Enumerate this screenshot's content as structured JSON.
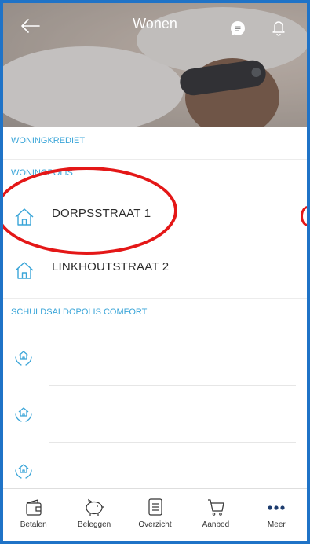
{
  "header": {
    "title": "Wonen",
    "icons": [
      "arrow-left-icon",
      "chat-icon",
      "bell-icon"
    ]
  },
  "sections": {
    "woningkrediet": "WONINGKREDIET",
    "woningpolis": "WONINGPOLIS",
    "schuldsaldo": "SCHULDSALDOPOLIS COMFORT"
  },
  "woningpolis_items": [
    {
      "label": "DORPSSTRAAT 1",
      "icon": "house-icon"
    },
    {
      "label": "LINKHOUTSTRAAT 2",
      "icon": "house-icon"
    }
  ],
  "schuldsaldo_items": [
    {
      "icon": "protected-house-icon"
    },
    {
      "icon": "protected-house-icon"
    },
    {
      "icon": "protected-house-icon"
    }
  ],
  "bottomnav": {
    "items": [
      {
        "label": "Betalen",
        "icon": "wallet-icon"
      },
      {
        "label": "Beleggen",
        "icon": "piggy-bank-icon"
      },
      {
        "label": "Overzicht",
        "icon": "document-icon"
      },
      {
        "label": "Aanbod",
        "icon": "cart-icon"
      },
      {
        "label": "Meer",
        "icon": "more-icon"
      }
    ]
  },
  "colors": {
    "accent": "#3aa5d8",
    "frame": "#1f73c7",
    "annotation": "#e41717",
    "nav_active": "#1d3c6e"
  }
}
